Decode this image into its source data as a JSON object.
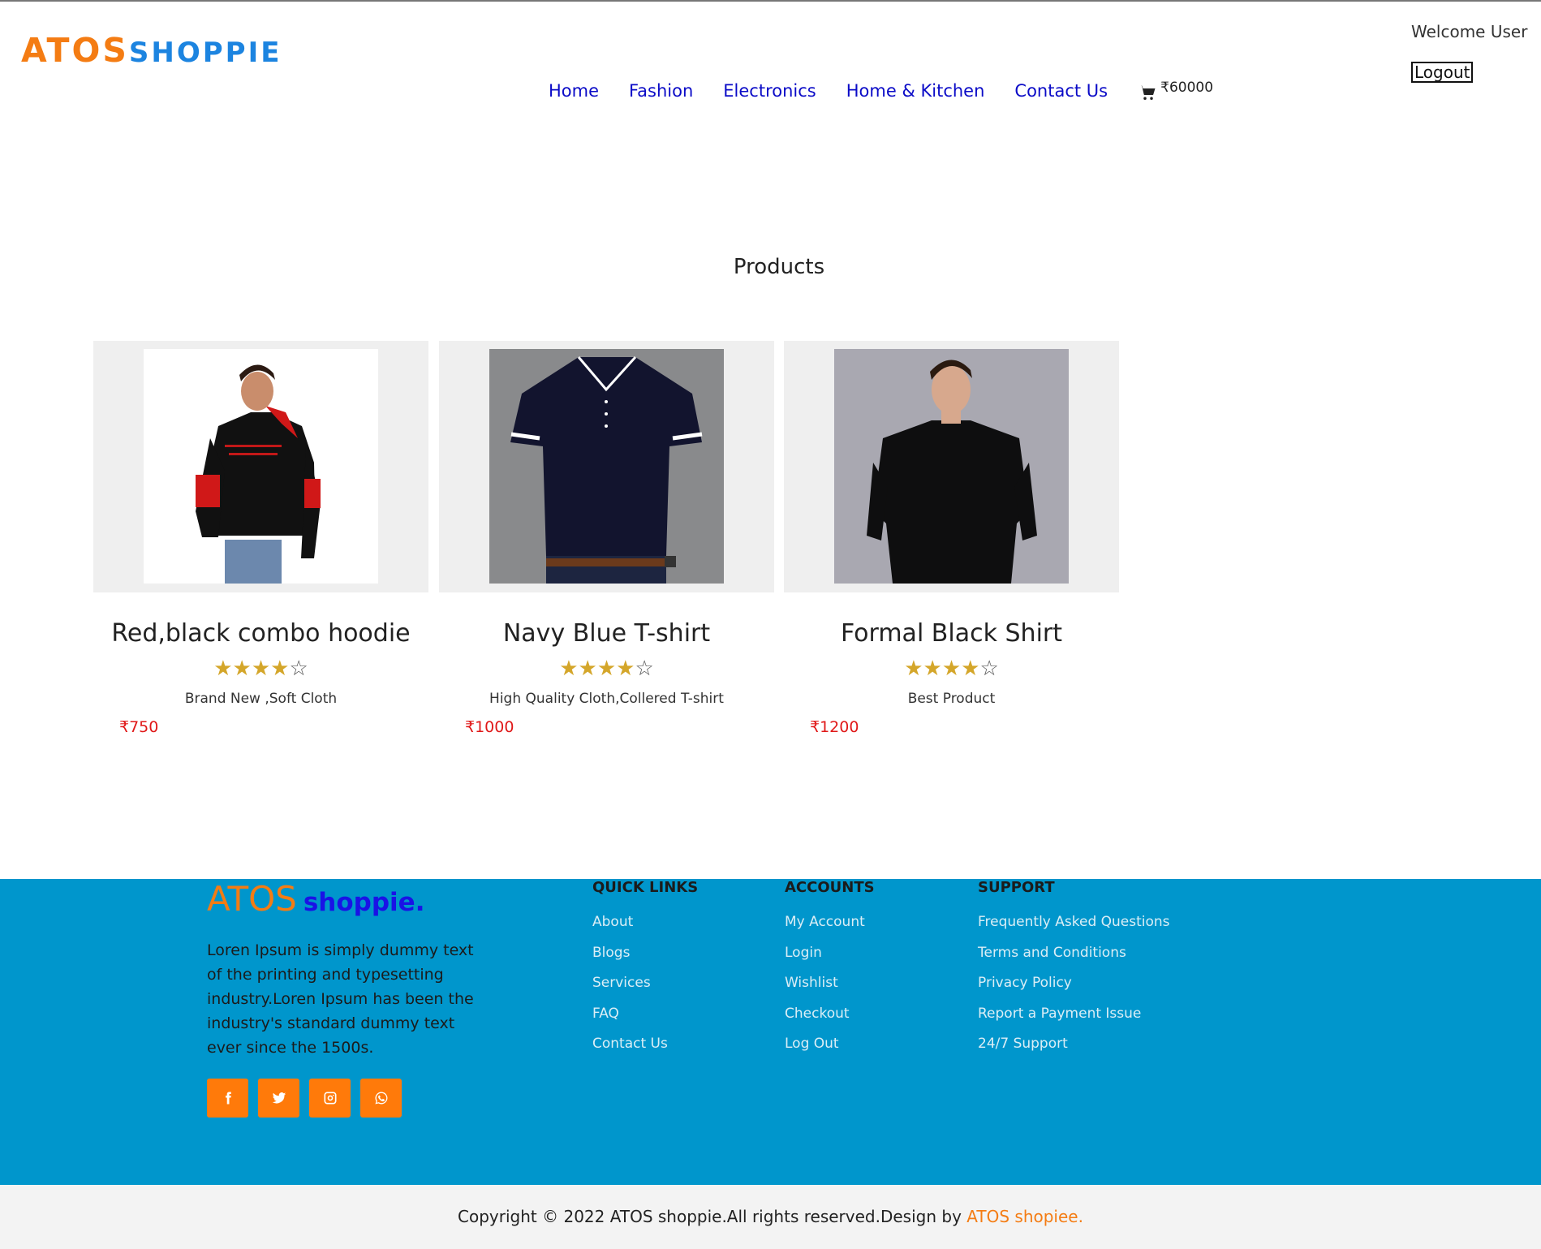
{
  "header": {
    "brand_part1": "ATOS",
    "brand_part2": "SHOPPIE",
    "nav": [
      "Home",
      "Fashion",
      "Electronics",
      "Home & Kitchen",
      "Contact Us"
    ],
    "cart_amount": "₹60000",
    "welcome": "Welcome User",
    "logout": "Logout"
  },
  "products_title": "Products",
  "products": [
    {
      "name": "Red,black combo hoodie",
      "rating": 4,
      "stars_filled": "★★★★",
      "stars_empty": "☆",
      "desc": "Brand New ,Soft Cloth",
      "price": "₹750"
    },
    {
      "name": "Navy Blue T-shirt",
      "rating": 4,
      "stars_filled": "★★★★",
      "stars_empty": "☆",
      "desc": "High Quality Cloth,Collered T-shirt",
      "price": "₹1000"
    },
    {
      "name": "Formal Black Shirt",
      "rating": 4,
      "stars_filled": "★★★★",
      "stars_empty": "☆",
      "desc": "Best Product",
      "price": "₹1200"
    }
  ],
  "footer": {
    "logo_part1": "ATOS",
    "logo_part2": "shoppie.",
    "description": "Loren Ipsum is simply dummy text of the printing and typesetting industry.Loren Ipsum has been the industry's standard dummy text ever since the 1500s.",
    "social_icons": [
      "facebook-icon",
      "twitter-icon",
      "instagram-icon",
      "whatsapp-icon"
    ],
    "quick_links": {
      "title": "QUICK LINKS",
      "items": [
        "About",
        "Blogs",
        "Services",
        "FAQ",
        "Contact Us"
      ]
    },
    "accounts": {
      "title": "ACCOUNTS",
      "items": [
        "My Account",
        "Login",
        "Wishlist",
        "Checkout",
        "Log Out"
      ]
    },
    "support": {
      "title": "SUPPORT",
      "items": [
        "Frequently Asked Questions",
        "Terms and Conditions",
        "Privacy Policy",
        "Report a Payment Issue",
        "24/7 Support"
      ]
    }
  },
  "copyright": {
    "text": "Copyright © 2022 ATOS shoppie.All rights reserved.Design by ",
    "highlight": "ATOS shopiee."
  },
  "colors": {
    "brand_orange": "#f47c13",
    "brand_blue": "#1c84e0",
    "nav_link": "#0b0bc7",
    "footer_bg": "#0096cc",
    "price_red": "#e01818",
    "star_gold": "#d4a62a",
    "social_btn": "#ff7a0a"
  }
}
